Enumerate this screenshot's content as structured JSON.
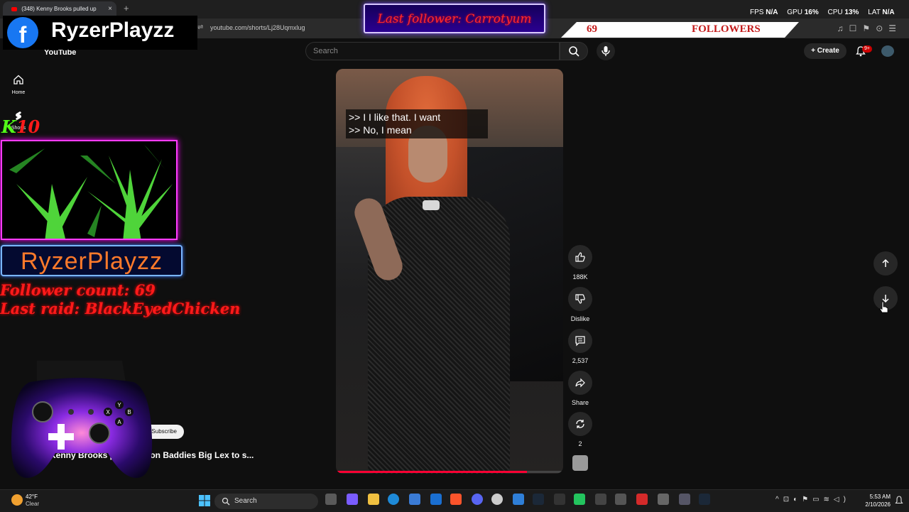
{
  "browser": {
    "tab_title": "(348) Kenny Brooks pulled up",
    "tab_close": "×",
    "new_tab": "+",
    "url": "youtube.com/shorts/Lj28Uqmxlug"
  },
  "youtube": {
    "logo": "YouTube",
    "search_placeholder": "Search",
    "create_label": "Create",
    "notification_badge": "9+",
    "nav": [
      {
        "label": "Home",
        "icon": "home-icon"
      },
      {
        "label": "Shorts",
        "icon": "shorts-icon"
      }
    ]
  },
  "short": {
    "captions": [
      ">> I I like that. I want",
      ">> No, I mean"
    ],
    "progress_fraction": 0.84,
    "actions": [
      {
        "icon": "thumb-up-icon",
        "label": "188K"
      },
      {
        "icon": "thumb-down-icon",
        "label": "Dislike"
      },
      {
        "icon": "comment-icon",
        "label": "2,537"
      },
      {
        "icon": "share-icon",
        "label": "Share"
      },
      {
        "icon": "remix-icon",
        "label": "2"
      }
    ],
    "title_partial": "Kenny Brooks pulled up on Baddies Big Lex to s...",
    "subscribe_label": "Subscribe"
  },
  "overlays": {
    "fb_name": "RyzerPlayzz",
    "last_follower": "Last follower: Carrotyum",
    "followers_count": "69",
    "followers_label": "FOLLOWERS",
    "stats": [
      {
        "label": "FPS",
        "value": "N/A"
      },
      {
        "label": "GPU",
        "value": "16%"
      },
      {
        "label": "CPU",
        "value": "13%"
      },
      {
        "label": "LAT",
        "value": "N/A"
      }
    ],
    "kick_k": "K",
    "kick_number": "10",
    "name_box": "RyzerPlayzz",
    "follower_count_line": "Follower count: 69",
    "last_raid_line": "Last raid: BlackEyedChicken"
  },
  "taskbar": {
    "weather_temp": "42°F",
    "weather_desc": "Clear",
    "search_label": "Search",
    "time": "5:53 AM",
    "date": "2/10/2026"
  },
  "colors": {
    "accent_red": "#ff0033",
    "overlay_red": "#ff1a1a",
    "facebook_blue": "#1877f2",
    "neon_pink": "#ff3cff"
  }
}
